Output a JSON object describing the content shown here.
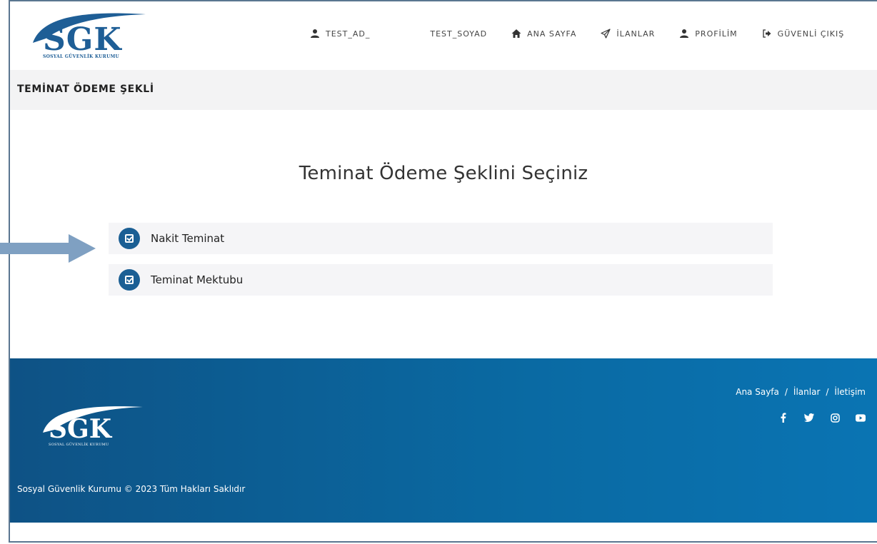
{
  "brand": {
    "logo_text": "SGK",
    "logo_subtitle": "SOSYAL GÜVENLİK KURUMU",
    "primary_color": "#1b5f94",
    "footer_color": "#0a6aa3"
  },
  "nav": {
    "user_first": "TEST_AD_",
    "user_last": "TEST_SOYAD",
    "home": "ANA SAYFA",
    "listings": "İLANLAR",
    "profile": "PROFİLİM",
    "logout": "GÜVENLİ ÇIKIŞ"
  },
  "page": {
    "section_title": "TEMİNAT ÖDEME ŞEKLİ",
    "heading": "Teminat Ödeme Şeklini Seçiniz",
    "options": [
      {
        "label": "Nakit Teminat"
      },
      {
        "label": "Teminat Mektubu"
      }
    ]
  },
  "footer": {
    "links": [
      "Ana Sayfa",
      "İlanlar",
      "İletişim"
    ],
    "link_separator": "/",
    "social_icons": [
      "facebook-icon",
      "twitter-icon",
      "instagram-icon",
      "youtube-icon"
    ],
    "copyright": "Sosyal Güvenlik Kurumu © 2023 Tüm Hakları Saklıdır"
  }
}
